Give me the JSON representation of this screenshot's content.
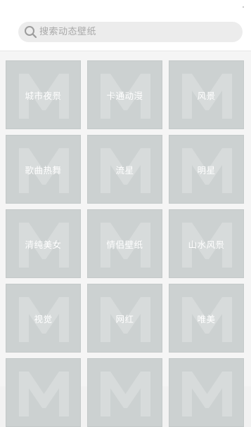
{
  "search": {
    "placeholder": "搜索动态壁纸"
  },
  "categories": [
    {
      "label": "城市夜景"
    },
    {
      "label": "卡通动漫"
    },
    {
      "label": "风景"
    },
    {
      "label": "歌曲热舞"
    },
    {
      "label": "流星"
    },
    {
      "label": "明星"
    },
    {
      "label": "清纯美女"
    },
    {
      "label": "情侣壁纸"
    },
    {
      "label": "山水风景"
    },
    {
      "label": "视觉"
    },
    {
      "label": "网红"
    },
    {
      "label": "唯美"
    },
    {
      "label": ""
    },
    {
      "label": ""
    },
    {
      "label": ""
    }
  ],
  "colors": {
    "tile_background": "#ccd1d1",
    "watermark": "#d8dcdc",
    "search_background": "#ececec",
    "placeholder_text": "#a9a9a9"
  },
  "icons": {
    "search": "search-icon",
    "tile_watermark": "m-logo-icon"
  }
}
